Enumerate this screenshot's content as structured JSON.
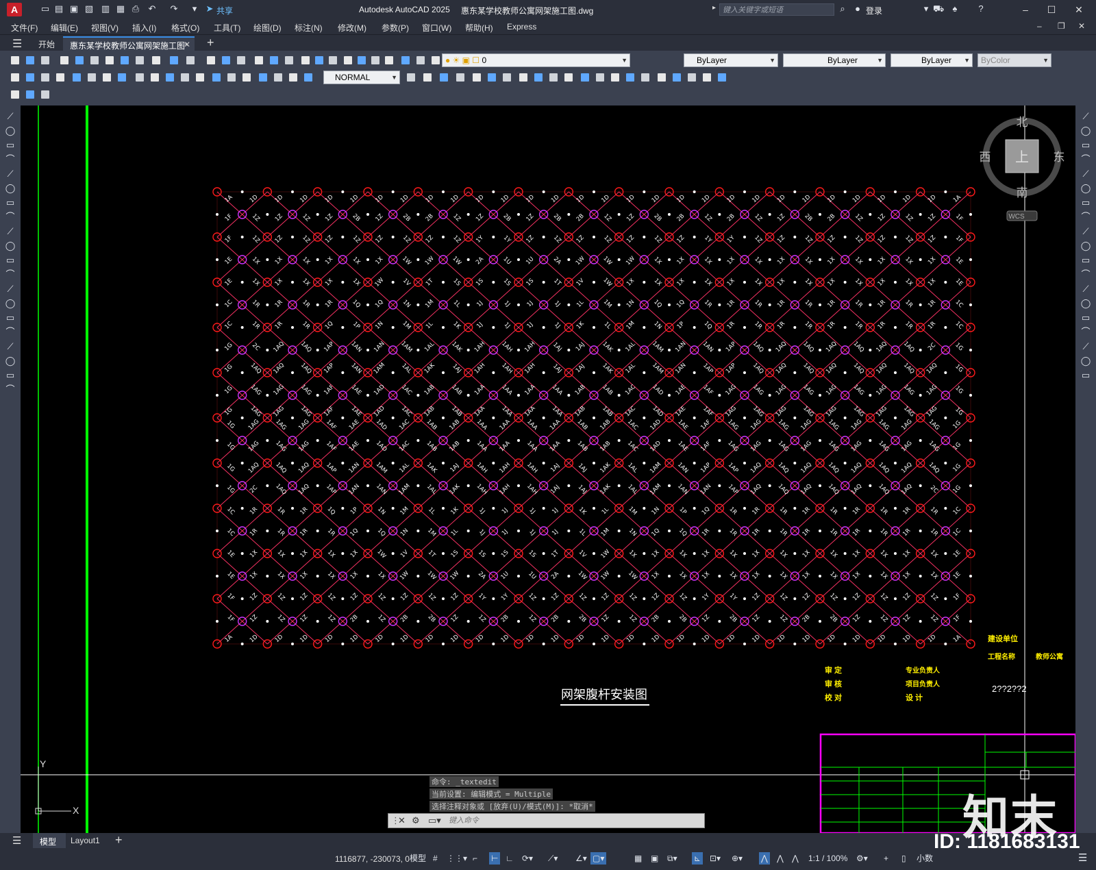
{
  "titlebar": {
    "app_title": "Autodesk AutoCAD 2025",
    "doc_title": "惠东某学校教师公寓网架施工图.dwg",
    "share_label": "共享",
    "search_placeholder": "键入关键字或短语",
    "signin_label": "登录"
  },
  "menubar": {
    "items": [
      "文件(F)",
      "编辑(E)",
      "视图(V)",
      "插入(I)",
      "格式(O)",
      "工具(T)",
      "绘图(D)",
      "标注(N)",
      "修改(M)",
      "参数(P)",
      "窗口(W)",
      "帮助(H)",
      "Express"
    ]
  },
  "tabs": {
    "start": "开始",
    "document": "惠东某学校教师公寓网架施工图*"
  },
  "toolbar": {
    "layer_value": "0",
    "color_value": "ByLayer",
    "linetype_value": "ByLayer",
    "lineweight_value": "ByLayer",
    "plotstyle_value": "ByColor",
    "textstyle_value": "NORMAL"
  },
  "viewcube": {
    "north": "北",
    "south": "南",
    "east": "东",
    "west": "西",
    "face": "上",
    "wcs": "WCS"
  },
  "drawing": {
    "title": "网架腹杆安装图",
    "colors": {
      "chord": "#ff2a2a",
      "web": "#ff3366",
      "node_red": "#ff1a1a",
      "node_magenta": "#cc33ff",
      "frame": "#00ff00",
      "title_block": "#ff00ff"
    },
    "top_labels": [
      "1A",
      "1D",
      "1D",
      "1D",
      "1D",
      "1D",
      "1D",
      "1D",
      "1D",
      "1D",
      "1D",
      "1D",
      "1D",
      "1D",
      "1D",
      "1D",
      "1D",
      "1D",
      "1D",
      "1D",
      "1D",
      "1D",
      "1D",
      "1D",
      "1D",
      "1D",
      "1D",
      "1D",
      "1D",
      "1A"
    ],
    "row_labels": [
      [
        "1F",
        "1Z",
        "1Z",
        "1Z",
        "1Z",
        "2B",
        "1Z",
        "2B",
        "2B",
        "1Z",
        "1Z",
        "2B",
        "1Z",
        "2B",
        "2B",
        "1Z",
        "1Z",
        "2B",
        "2B",
        "1Z",
        "2B",
        "1Z",
        "1Z",
        "2B",
        "2B",
        "1Z",
        "1Z",
        "1Z",
        "1Z",
        "1F"
      ],
      [
        "1F",
        "1Z",
        "1Z",
        "1Z",
        "1Z",
        "1Z",
        "1Z",
        "1Z",
        "1Z",
        "1Z",
        "1Y",
        "1Y",
        "1Z",
        "1Z",
        "1Z",
        "1Z",
        "1Z",
        "1Z",
        "1Z",
        "1Y",
        "1Y",
        "1Z",
        "1Z",
        "1Z",
        "1Z",
        "1Z",
        "1Z",
        "1Z",
        "1Z",
        "1F"
      ],
      [
        "1E",
        "1X",
        "1X",
        "1X",
        "1X",
        "1X",
        "1X",
        "1W",
        "1W",
        "1W",
        "2A",
        "1U",
        "1U",
        "2A",
        "1W",
        "1W",
        "1W",
        "1X",
        "1X",
        "1X",
        "1X",
        "1X",
        "1X",
        "1X",
        "1X",
        "1X",
        "1X",
        "1X",
        "1X",
        "1E"
      ],
      [
        "1E",
        "1X",
        "1X",
        "1X",
        "1X",
        "1X",
        "1W",
        "1V",
        "1T",
        "1S",
        "1S",
        "1S",
        "1S",
        "1T",
        "1V",
        "1W",
        "1X",
        "1X",
        "1X",
        "1X",
        "1X",
        "1X",
        "1X",
        "1X",
        "1X",
        "1X",
        "1X",
        "1X",
        "1X",
        "1E"
      ],
      [
        "1C",
        "1R",
        "1R",
        "1R",
        "1R",
        "1Q",
        "1Q",
        "1N",
        "1M",
        "1L",
        "1J",
        "1J",
        "1J",
        "1J",
        "1L",
        "1M",
        "1N",
        "1Q",
        "1Q",
        "1R",
        "1R",
        "1R",
        "1R",
        "1R",
        "1R",
        "1R",
        "1R",
        "1R",
        "1R",
        "1C"
      ],
      [
        "1C",
        "1R",
        "1R",
        "1R",
        "1Q",
        "1P",
        "1N",
        "1M",
        "1L",
        "1K",
        "1J",
        "1J",
        "1J",
        "1J",
        "1K",
        "1L",
        "1M",
        "1N",
        "1P",
        "1Q",
        "1R",
        "1R",
        "1R",
        "1R",
        "1R",
        "1R",
        "1R",
        "1R",
        "1R",
        "1C"
      ],
      [
        "1G",
        "2C",
        "1AQ",
        "1AQ",
        "1AP",
        "1AN",
        "1AN",
        "1AM",
        "1AL",
        "1AK",
        "1AH",
        "1AH",
        "1AH",
        "1AJ",
        "1AJ",
        "1AK",
        "1AL",
        "1AM",
        "1AN",
        "1AN",
        "1AP",
        "1AQ",
        "1AQ",
        "1AQ",
        "1AQ",
        "1AQ",
        "1AQ",
        "1AQ",
        "2C",
        "1G"
      ],
      [
        "1G",
        "1AQ",
        "1AQ",
        "1AQ",
        "1AP",
        "1AN",
        "1AM",
        "1AL",
        "1AK",
        "1AJ",
        "1AH",
        "1AH",
        "1AH",
        "1AJ",
        "1AJ",
        "1AK",
        "1AL",
        "1AM",
        "1AN",
        "1AP",
        "1AP",
        "1AQ",
        "1AQ",
        "1AQ",
        "1AQ",
        "1AQ",
        "1AQ",
        "1AQ",
        "1AQ",
        "1G"
      ],
      [
        "1G",
        "1AG",
        "1AG",
        "1AG",
        "1AF",
        "1AE",
        "1AD",
        "1AC",
        "1AB",
        "1AB",
        "1AA",
        "1AA",
        "1AA",
        "1AA",
        "1AB",
        "1AB",
        "1AC",
        "1AD",
        "1AE",
        "1AF",
        "1AG",
        "1AG",
        "1AG",
        "1AG",
        "1AG",
        "1AG",
        "1AG",
        "1AG",
        "1AG",
        "1G"
      ],
      [
        "1G",
        "1AG",
        "1AG",
        "1AG",
        "1AF",
        "1AE",
        "1AD",
        "1AC",
        "1AB",
        "1AB",
        "1AA",
        "1AA",
        "1AA",
        "1AA",
        "1AB",
        "1AB",
        "1AC",
        "1AD",
        "1AE",
        "1AF",
        "1AG",
        "1AG",
        "1AG",
        "1AG",
        "1AG",
        "1AG",
        "1AG",
        "1AG",
        "1AG",
        "1G"
      ]
    ],
    "bottom_labels": [
      "1A",
      "1D",
      "1D",
      "1D",
      "1D",
      "1D",
      "1D",
      "1D",
      "1D",
      "1D",
      "1D",
      "1D",
      "1D",
      "1D",
      "1D",
      "1D",
      "1D",
      "1D",
      "1D",
      "1D",
      "1D",
      "1D",
      "1D",
      "1D",
      "1D",
      "1D",
      "1D",
      "1D",
      "1D",
      "1A"
    ]
  },
  "title_block": {
    "owner_label": "建设单位",
    "project_label": "工程名称",
    "project_value": "教师公寓",
    "review_label": "审   定",
    "audit_label": "审   核",
    "check_label": "校   对",
    "lead_label": "专业负责人",
    "pm_label": "项目负责人",
    "design_label": "设   计",
    "drawing_no": "2??2??2"
  },
  "command": {
    "line1": "命令: _textedit",
    "line2": "当前设置: 编辑模式 = Multiple",
    "line3": "选择注释对象或 [放弃(U)/模式(M)]: *取消*",
    "placeholder": "键入命令"
  },
  "layout_tabs": {
    "model": "模型",
    "layout1": "Layout1"
  },
  "statusbar": {
    "coords": "1116877, -230073, 0",
    "model_label": "模型",
    "scale": "1:1 / 100%",
    "units": "小数"
  },
  "watermark": {
    "brand": "知末",
    "id": "ID: 1181683131"
  }
}
